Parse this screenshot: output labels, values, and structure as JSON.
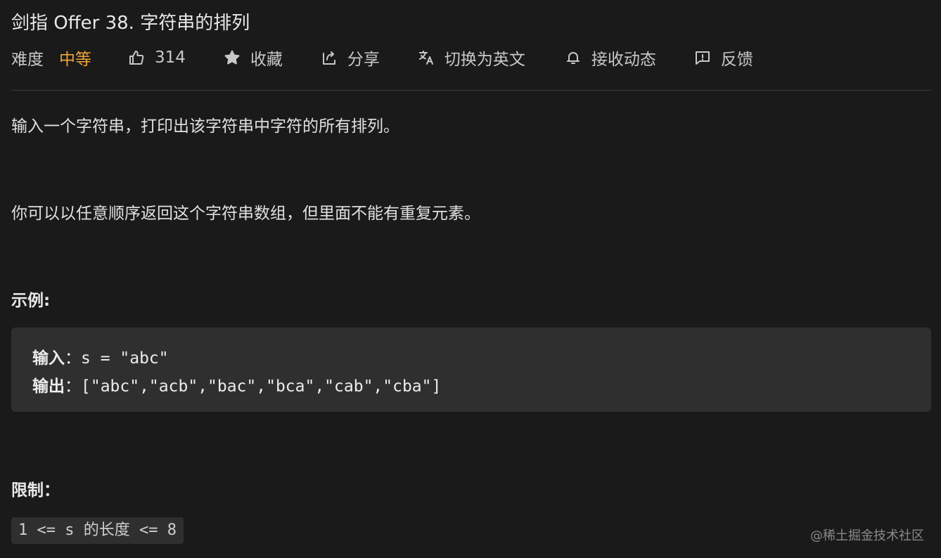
{
  "problem": {
    "title": "剑指 Offer 38. 字符串的排列"
  },
  "meta": {
    "difficulty_label": "难度",
    "difficulty_value": "中等",
    "difficulty_color": "#f0a338",
    "likes": "314",
    "favorite_label": "收藏",
    "share_label": "分享",
    "translate_label": "切换为英文",
    "subscribe_label": "接收动态",
    "feedback_label": "反馈",
    "icons": [
      "thumbs-up-icon",
      "star-icon",
      "share-icon",
      "translate-icon",
      "bell-icon",
      "feedback-icon"
    ]
  },
  "description": {
    "para1": "输入一个字符串，打印出该字符串中字符的所有排列。",
    "para2": "你可以以任意顺序返回这个字符串数组，但里面不能有重复元素。"
  },
  "example": {
    "heading": "示例:",
    "input_label": "输入",
    "input_value": "：s = \"abc\"",
    "output_label": "输出",
    "output_value": "：[\"abc\",\"acb\",\"bac\",\"bca\",\"cab\",\"cba\"]"
  },
  "constraints": {
    "heading": "限制：",
    "constraint": "1 <= s 的长度 <= 8"
  },
  "watermark": "@稀土掘金技术社区"
}
